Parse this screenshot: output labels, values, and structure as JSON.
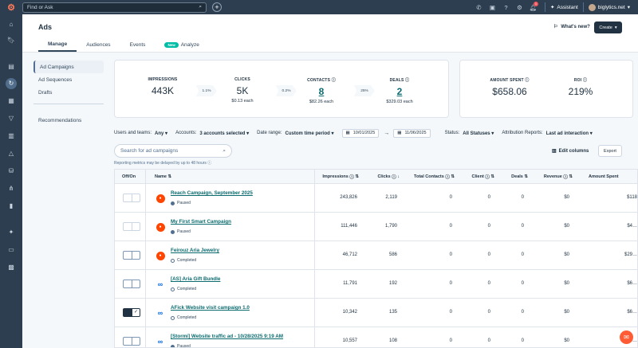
{
  "topbar": {
    "search_placeholder": "Find or Ask",
    "assistant_label": "Assistant",
    "account_name": "biglytics.net",
    "notification_count": "1"
  },
  "header": {
    "title": "Ads",
    "whats_new": "What's new?",
    "create_label": "Create",
    "tabs": [
      {
        "label": "Manage"
      },
      {
        "label": "Audiences"
      },
      {
        "label": "Events"
      },
      {
        "label": "Analyze",
        "badge": "New"
      }
    ]
  },
  "subnav": {
    "items": [
      {
        "label": "Ad Campaigns"
      },
      {
        "label": "Ad Sequences"
      },
      {
        "label": "Drafts"
      },
      {
        "label": "Recommendations"
      }
    ]
  },
  "stats": {
    "impressions": {
      "label": "IMPRESSIONS",
      "value": "443K"
    },
    "rate1": "1.1%",
    "clicks": {
      "label": "CLICKS",
      "value": "5K",
      "sub": "$0.13 each"
    },
    "rate2": "0.2%",
    "contacts": {
      "label": "CONTACTS",
      "value": "8",
      "sub": "$82.26 each"
    },
    "rate3": "25%",
    "deals": {
      "label": "DEALS",
      "value": "2",
      "sub": "$329.03 each"
    },
    "amount_spent": {
      "label": "AMOUNT SPENT",
      "value": "$658.06"
    },
    "roi": {
      "label": "ROI",
      "value": "219%"
    }
  },
  "filters": {
    "users_label": "Users and teams:",
    "users_value": "Any",
    "accounts_label": "Accounts:",
    "accounts_value": "3 accounts selected",
    "date_label": "Date range:",
    "date_value": "Custom time period",
    "date_from": "10/01/2025",
    "date_to": "11/06/2025",
    "status_label": "Status:",
    "status_value": "All Statuses",
    "attribution_label": "Attribution Reports:",
    "attribution_value": "Last ad interaction"
  },
  "toolbar": {
    "search_placeholder": "Search for ad campaigns",
    "delay_note": "Reporting metrics may be delayed by up to 48 hours",
    "edit_columns": "Edit columns",
    "export": "Export"
  },
  "table": {
    "columns": {
      "onoff": "Off/On",
      "name": "Name",
      "impressions": "Impressions",
      "clicks": "Clicks",
      "total_contacts": "Total Contacts",
      "client": "Client",
      "deals": "Deals",
      "revenue": "Revenue",
      "amount_spent": "Amount Spent"
    },
    "rows": [
      {
        "platform": "reddit",
        "toggle": "off",
        "name": "Reach Campaign, September 2025",
        "status": "Paused",
        "impressions": "243,826",
        "clicks": "2,119",
        "contacts": "0",
        "client": "0",
        "deals": "0",
        "revenue": "$0",
        "spent": "$118"
      },
      {
        "platform": "reddit",
        "toggle": "off",
        "name": "My First Smart Campaign",
        "status": "Paused",
        "impressions": "111,446",
        "clicks": "1,790",
        "contacts": "0",
        "client": "0",
        "deals": "0",
        "revenue": "$0",
        "spent": "$4…"
      },
      {
        "platform": "reddit",
        "toggle": "off-dark",
        "name": "Feirouz Aria Jewelry",
        "status": "Completed",
        "impressions": "46,712",
        "clicks": "586",
        "contacts": "0",
        "client": "0",
        "deals": "0",
        "revenue": "$0",
        "spent": "$29…"
      },
      {
        "platform": "meta",
        "toggle": "off-dark",
        "name": "[AS] Aria Gift Bundle",
        "status": "Completed",
        "impressions": "11,791",
        "clicks": "192",
        "contacts": "0",
        "client": "0",
        "deals": "0",
        "revenue": "$0",
        "spent": "$6…"
      },
      {
        "platform": "meta",
        "toggle": "on",
        "name": "AFick Website visit campaign 1.0",
        "status": "Completed",
        "impressions": "10,342",
        "clicks": "135",
        "contacts": "0",
        "client": "0",
        "deals": "0",
        "revenue": "$0",
        "spent": "$6…"
      },
      {
        "platform": "meta",
        "toggle": "off-dark",
        "name": "[Stormi] Website traffic ad - 10/28/2025 9:19 AM",
        "status": "Paused",
        "impressions": "10,557",
        "clicks": "108",
        "contacts": "0",
        "client": "0",
        "deals": "0",
        "revenue": "$0",
        "spent": "$4…"
      }
    ]
  }
}
